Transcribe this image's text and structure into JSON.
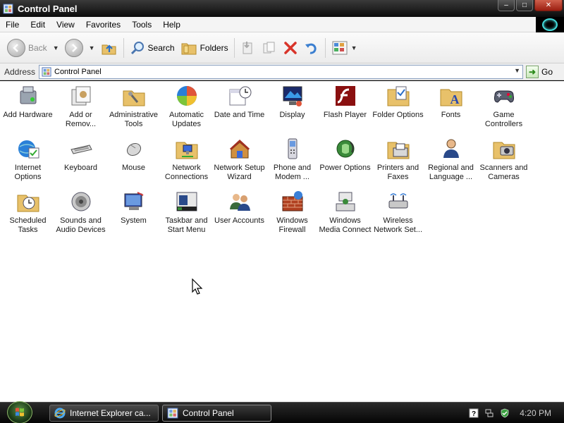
{
  "window": {
    "title": "Control Panel",
    "controls": {
      "minimize": "–",
      "maximize": "□",
      "close": "✕"
    }
  },
  "menubar": {
    "items": [
      "File",
      "Edit",
      "View",
      "Favorites",
      "Tools",
      "Help"
    ]
  },
  "toolbar": {
    "back_label": "Back",
    "search_label": "Search",
    "folders_label": "Folders"
  },
  "addressbar": {
    "label": "Address",
    "value": "Control Panel",
    "go_label": "Go"
  },
  "items": [
    {
      "label": "Add Hardware",
      "icon": "add-hardware-icon"
    },
    {
      "label": "Add or\nRemov...",
      "icon": "add-remove-programs-icon"
    },
    {
      "label": "Administrative\nTools",
      "icon": "administrative-tools-icon"
    },
    {
      "label": "Automatic\nUpdates",
      "icon": "automatic-updates-icon"
    },
    {
      "label": "Date and Time",
      "icon": "date-time-icon"
    },
    {
      "label": "Display",
      "icon": "display-icon"
    },
    {
      "label": "Flash Player",
      "icon": "flash-player-icon"
    },
    {
      "label": "Folder Options",
      "icon": "folder-options-icon"
    },
    {
      "label": "Fonts",
      "icon": "fonts-icon"
    },
    {
      "label": "Game\nControllers",
      "icon": "game-controllers-icon"
    },
    {
      "label": "Internet\nOptions",
      "icon": "internet-options-icon"
    },
    {
      "label": "Keyboard",
      "icon": "keyboard-icon"
    },
    {
      "label": "Mouse",
      "icon": "mouse-icon"
    },
    {
      "label": "Network\nConnections",
      "icon": "network-connections-icon"
    },
    {
      "label": "Network Setup\nWizard",
      "icon": "network-setup-wizard-icon"
    },
    {
      "label": "Phone and\nModem ...",
      "icon": "phone-modem-icon"
    },
    {
      "label": "Power Options",
      "icon": "power-options-icon"
    },
    {
      "label": "Printers and\nFaxes",
      "icon": "printers-faxes-icon"
    },
    {
      "label": "Regional and\nLanguage ...",
      "icon": "regional-language-icon"
    },
    {
      "label": "Scanners and\nCameras",
      "icon": "scanners-cameras-icon"
    },
    {
      "label": "Scheduled\nTasks",
      "icon": "scheduled-tasks-icon"
    },
    {
      "label": "Sounds and\nAudio Devices",
      "icon": "sounds-audio-icon"
    },
    {
      "label": "System",
      "icon": "system-icon"
    },
    {
      "label": "Taskbar and\nStart Menu",
      "icon": "taskbar-start-menu-icon"
    },
    {
      "label": "User Accounts",
      "icon": "user-accounts-icon"
    },
    {
      "label": "Windows\nFirewall",
      "icon": "windows-firewall-icon"
    },
    {
      "label": "Windows\nMedia Connect",
      "icon": "windows-media-connect-icon"
    },
    {
      "label": "Wireless\nNetwork Set...",
      "icon": "wireless-network-setup-icon"
    }
  ],
  "taskbar": {
    "tasks": [
      {
        "label": "Internet Explorer ca...",
        "icon": "internet-explorer-icon"
      },
      {
        "label": "Control Panel",
        "icon": "control-panel-icon"
      }
    ],
    "clock": "4:20 PM"
  },
  "colors": {
    "titlebar": "#1a1a1a",
    "close_button": "#c0402e",
    "taskbar": "#111111"
  }
}
